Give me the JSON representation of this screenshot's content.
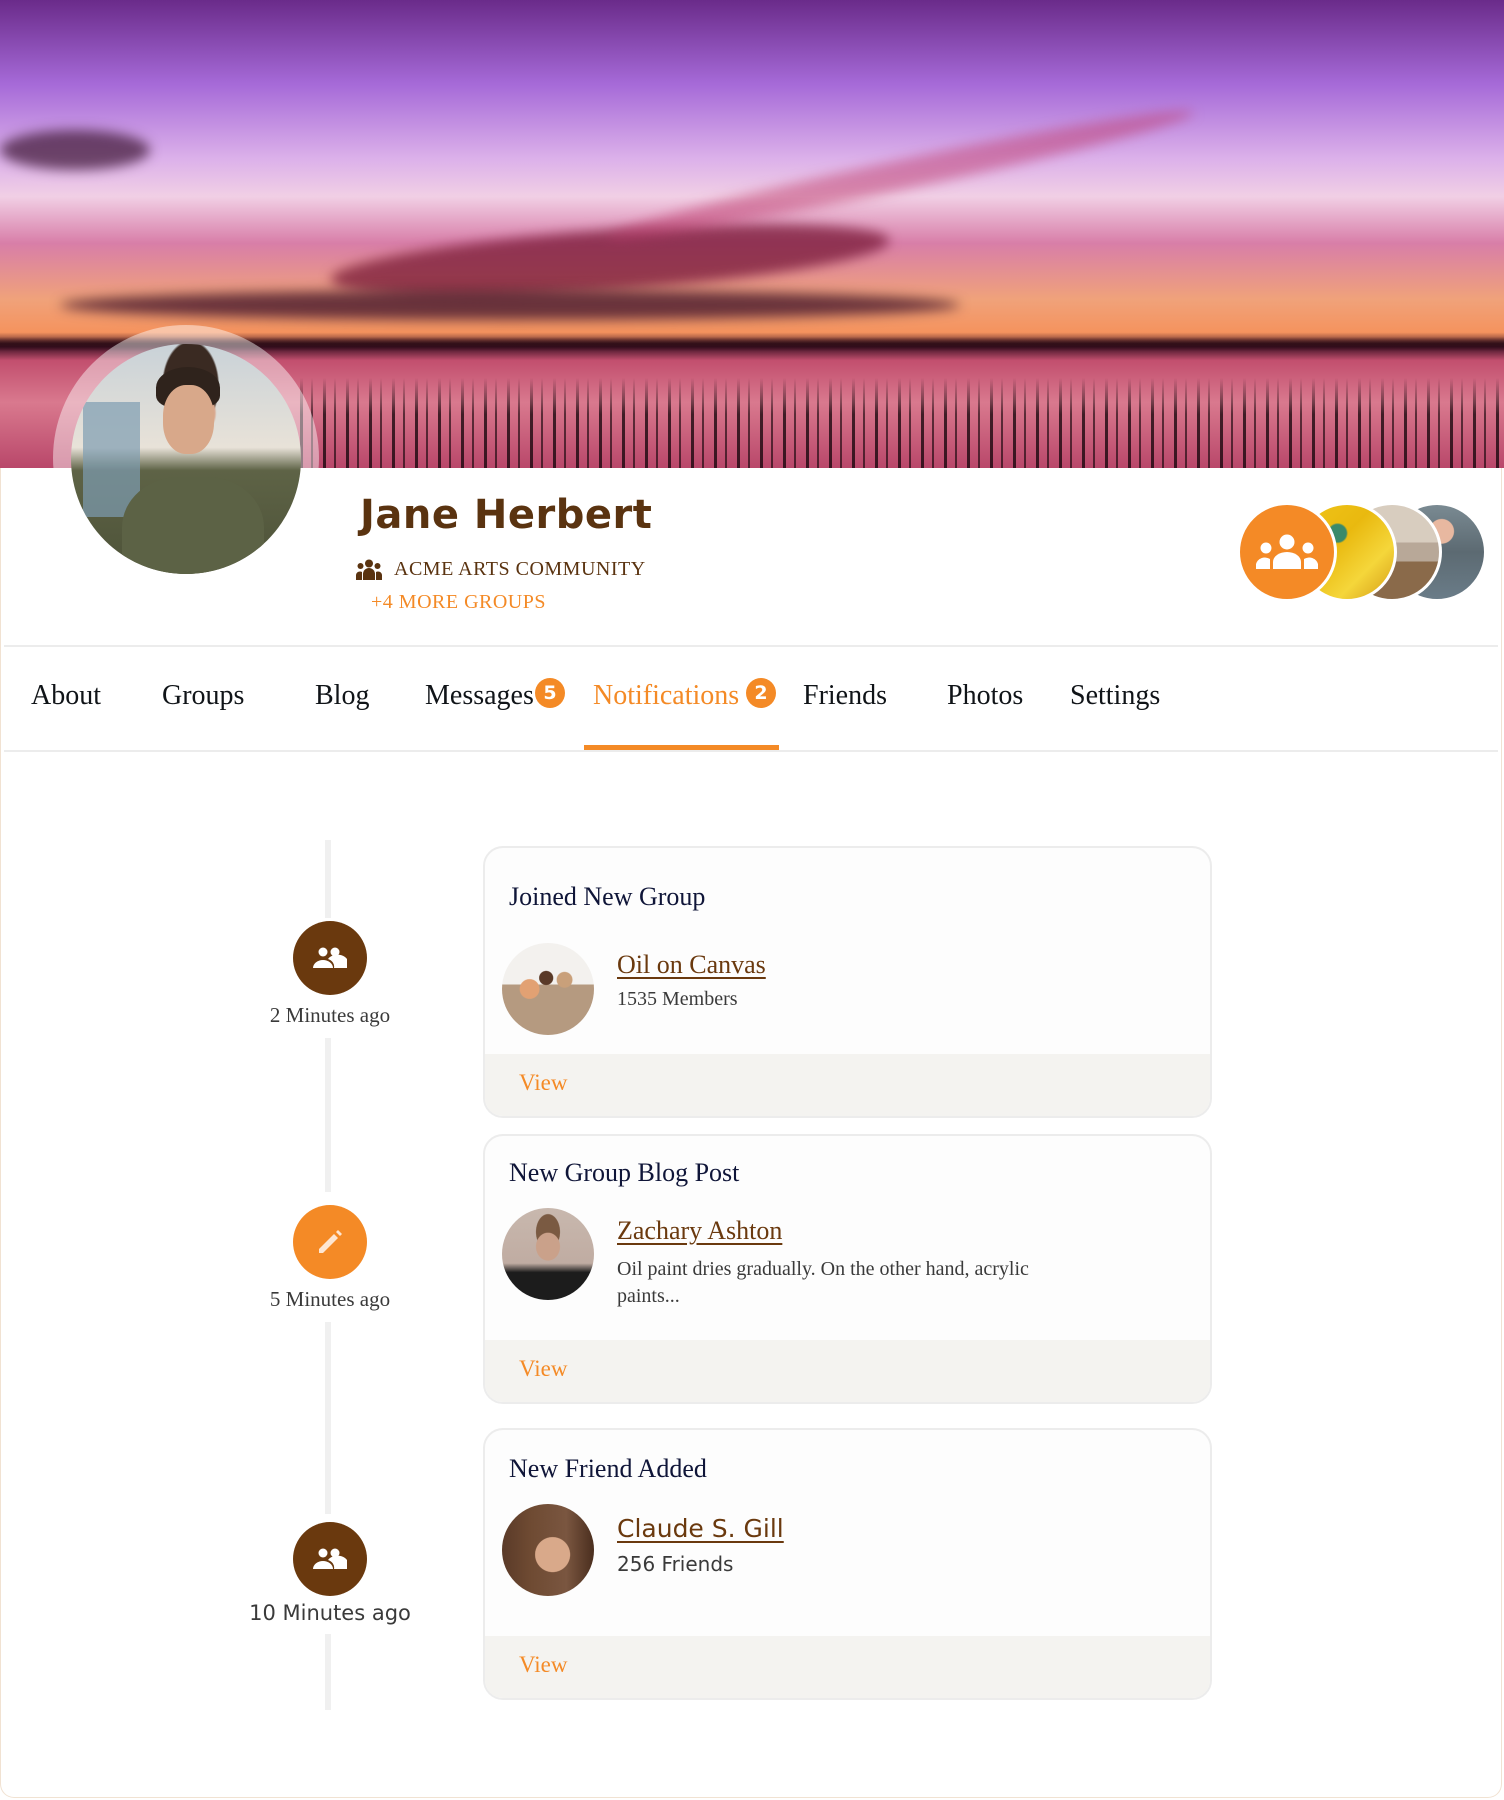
{
  "profile": {
    "name": "Jane Herbert",
    "primary_group": "ACME ARTS COMMUNITY",
    "more_groups": "+4 MORE GROUPS",
    "group_icon": "users-icon"
  },
  "group_stack": {
    "icon": "users-icon",
    "thumbnails": [
      "abstract-yellow-painting",
      "meeting-room",
      "smiling-man"
    ]
  },
  "tabs": [
    {
      "label": "About",
      "active": false
    },
    {
      "label": "Groups",
      "active": false
    },
    {
      "label": "Blog",
      "active": false
    },
    {
      "label": "Messages",
      "active": false,
      "badge": "5"
    },
    {
      "label": "Notifications",
      "active": true,
      "badge": "2"
    },
    {
      "label": "Friends",
      "active": false
    },
    {
      "label": "Photos",
      "active": false
    },
    {
      "label": "Settings",
      "active": false
    }
  ],
  "colors": {
    "accent": "#f48a26",
    "brown": "#6a390e",
    "name_brown": "#5a3310",
    "title_navy": "#0f1538",
    "footer_bg": "#f4f3f0"
  },
  "notifications": [
    {
      "time": "2 Minutes ago",
      "icon": "group-icon",
      "icon_color": "brown",
      "title": "Joined New Group",
      "link": "Oil on Canvas",
      "subtitle": "1535 Members",
      "action": "View"
    },
    {
      "time": "5 Minutes ago",
      "icon": "pencil-icon",
      "icon_color": "orange",
      "title": "New Group Blog Post",
      "link": "Zachary Ashton",
      "subtitle": "Oil paint dries gradually. On the other hand, acrylic paints...",
      "action": "View"
    },
    {
      "time": "10 Minutes ago",
      "icon": "group-icon",
      "icon_color": "brown",
      "title": "New Friend Added",
      "link": "Claude S. Gill",
      "subtitle": "256 Friends",
      "action": "View"
    }
  ]
}
